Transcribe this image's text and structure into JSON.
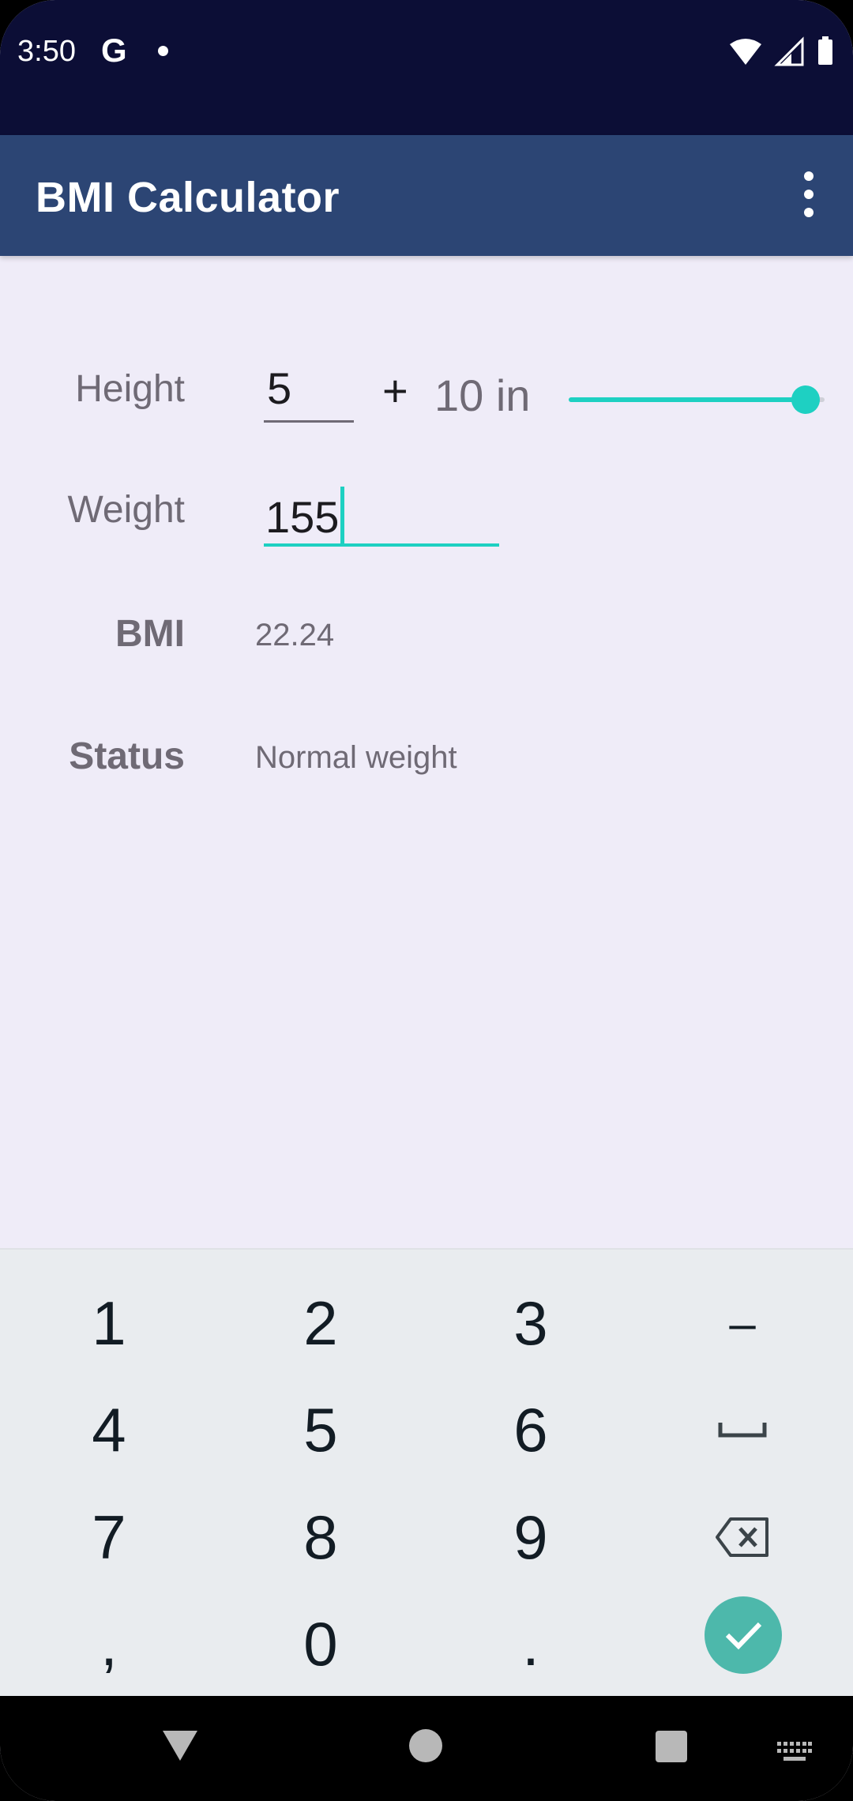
{
  "status_bar": {
    "time": "3:50",
    "g_icon": "G"
  },
  "app_bar": {
    "title": "BMI Calculator"
  },
  "form": {
    "height_label": "Height",
    "height_feet_value": "5",
    "plus_sign": "+",
    "height_inches_text": "10 in",
    "height_slider_value": 10,
    "weight_label": "Weight",
    "weight_value": "155",
    "bmi_label": "BMI",
    "bmi_value": "22.24",
    "status_label": "Status",
    "status_value": "Normal weight"
  },
  "keyboard": {
    "keys": [
      "1",
      "2",
      "3",
      "–",
      "4",
      "5",
      "6",
      "␣",
      "7",
      "8",
      "9",
      "⌫",
      ",",
      "0",
      ".",
      "✓"
    ]
  },
  "colors": {
    "status_bar_bg": "#0c0e36",
    "app_bar_bg": "#2c4574",
    "page_bg": "#efecf8",
    "accent": "#1ed0c2",
    "done_button": "#4db8ab"
  }
}
